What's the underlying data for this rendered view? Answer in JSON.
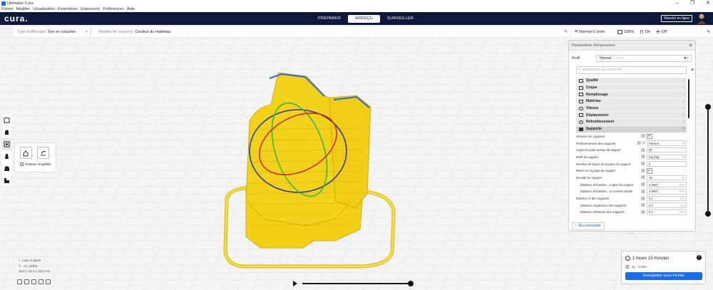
{
  "window": {
    "title": "Ultimaker Cura",
    "controls": [
      "–",
      "❐",
      "✕"
    ]
  },
  "menu": [
    "Fichier",
    "Modifier",
    "Visualisation",
    "Paramètres",
    "Extensions",
    "Préférences",
    "Aide"
  ],
  "header": {
    "logo": "cura.",
    "stages": [
      {
        "label": "PRÉPARER",
        "active": false
      },
      {
        "label": "APERÇU",
        "active": true
      },
      {
        "label": "SURVEILLER",
        "active": false
      }
    ],
    "marketplace": "Marché en ligne"
  },
  "viewbar": {
    "view_type_label": "Type d'affichage",
    "view_type_value": "Vue en couches",
    "color_scheme_label": "Modèle de couleurs",
    "color_scheme_value": "Couleur du matériau"
  },
  "printbar": {
    "profile": "Normal 0.1mm",
    "infill": "100%",
    "support": "On",
    "adhesion": "Off"
  },
  "rotate_tool": {
    "snap_label": "Rotation simplifiée"
  },
  "object": {
    "name": "Liste d'objets",
    "id": "AA_B0D2",
    "dims": "15,0 x 19,4 x 25,5 mm"
  },
  "panel": {
    "title": "Paramètres d'impression",
    "profile_label": "Profil",
    "profile_value": "Normal",
    "profile_hint": "0.1mm",
    "search_placeholder": "paramètres de recherche",
    "categories": [
      "Qualité",
      "Coque",
      "Remplissage",
      "Matériau",
      "Vitesse",
      "Déplacement",
      "Refroidissement",
      "Supports"
    ],
    "support_settings": [
      {
        "name": "Générer les supports",
        "type": "check",
        "value": "✔"
      },
      {
        "name": "Positionnement des supports",
        "type": "select",
        "value": "Partout"
      },
      {
        "name": "Angle de porte-à-faux de support",
        "type": "num",
        "value": "50",
        "unit": "°"
      },
      {
        "name": "Motif du support",
        "type": "select",
        "value": "Zig Zag"
      },
      {
        "name": "Nombre de lignes de la paroi du support",
        "type": "num",
        "value": "0",
        "unit": ""
      },
      {
        "name": "Relier les zigzags de support",
        "type": "check",
        "value": "✔"
      },
      {
        "name": "Densité du support",
        "type": "num",
        "value": "15",
        "unit": "%"
      },
      {
        "name": "Distance d'écartem...a ligne du support",
        "type": "num",
        "value": "2.6667",
        "unit": "mm",
        "indent": true
      },
      {
        "name": "Distance d'écartem... la couche initiale",
        "type": "num",
        "value": "2.6667",
        "unit": "mm",
        "indent": true
      },
      {
        "name": "Distance Z des supports",
        "type": "num",
        "value": "0.1",
        "unit": "mm"
      },
      {
        "name": "Distance supérieure des supports",
        "type": "num",
        "value": "0.1",
        "unit": "mm",
        "indent": true
      },
      {
        "name": "Distance inférieure des supports",
        "type": "num",
        "value": "0.1",
        "unit": "mm",
        "indent": true
      }
    ],
    "recommended_button": "Recommandé"
  },
  "job": {
    "time": "1 heure 15 minutes",
    "material": "3g · 0.89m",
    "save_button": "Enregistrer sous Fichier"
  },
  "colors": {
    "header": "#0e1a3d",
    "accent": "#196ef0",
    "model": "#f3d21b"
  }
}
